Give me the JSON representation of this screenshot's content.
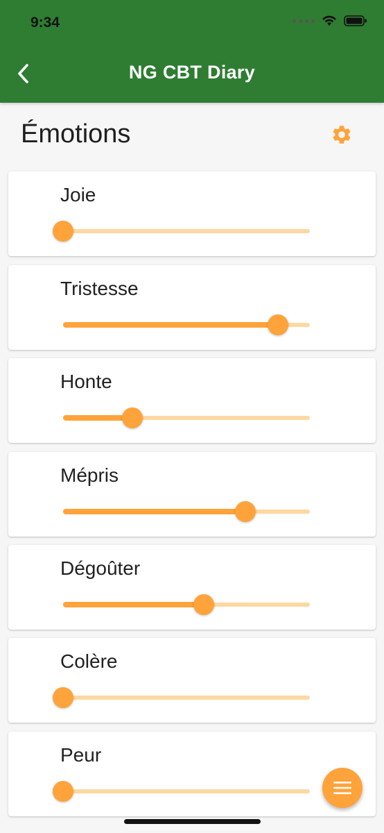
{
  "status_bar": {
    "time": "9:34"
  },
  "app_bar": {
    "title": "NG CBT Diary"
  },
  "section": {
    "title": "Émotions"
  },
  "emotions": [
    {
      "label": "Joie",
      "level": 0.0
    },
    {
      "label": "Tristesse",
      "level": 0.87
    },
    {
      "label": "Honte",
      "level": 0.28
    },
    {
      "label": "Mépris",
      "level": 0.74
    },
    {
      "label": "Dégoûter",
      "level": 0.57
    },
    {
      "label": "Colère",
      "level": 0.0
    },
    {
      "label": "Peur",
      "level": 0.0
    }
  ],
  "icons": {
    "back": "chevron-left-icon",
    "settings": "gear-icon",
    "fab": "menu-icon"
  },
  "colors": {
    "app_bar": "#2e7d32",
    "accent": "#ffa33a",
    "track_inactive": "#fdd8a3"
  }
}
